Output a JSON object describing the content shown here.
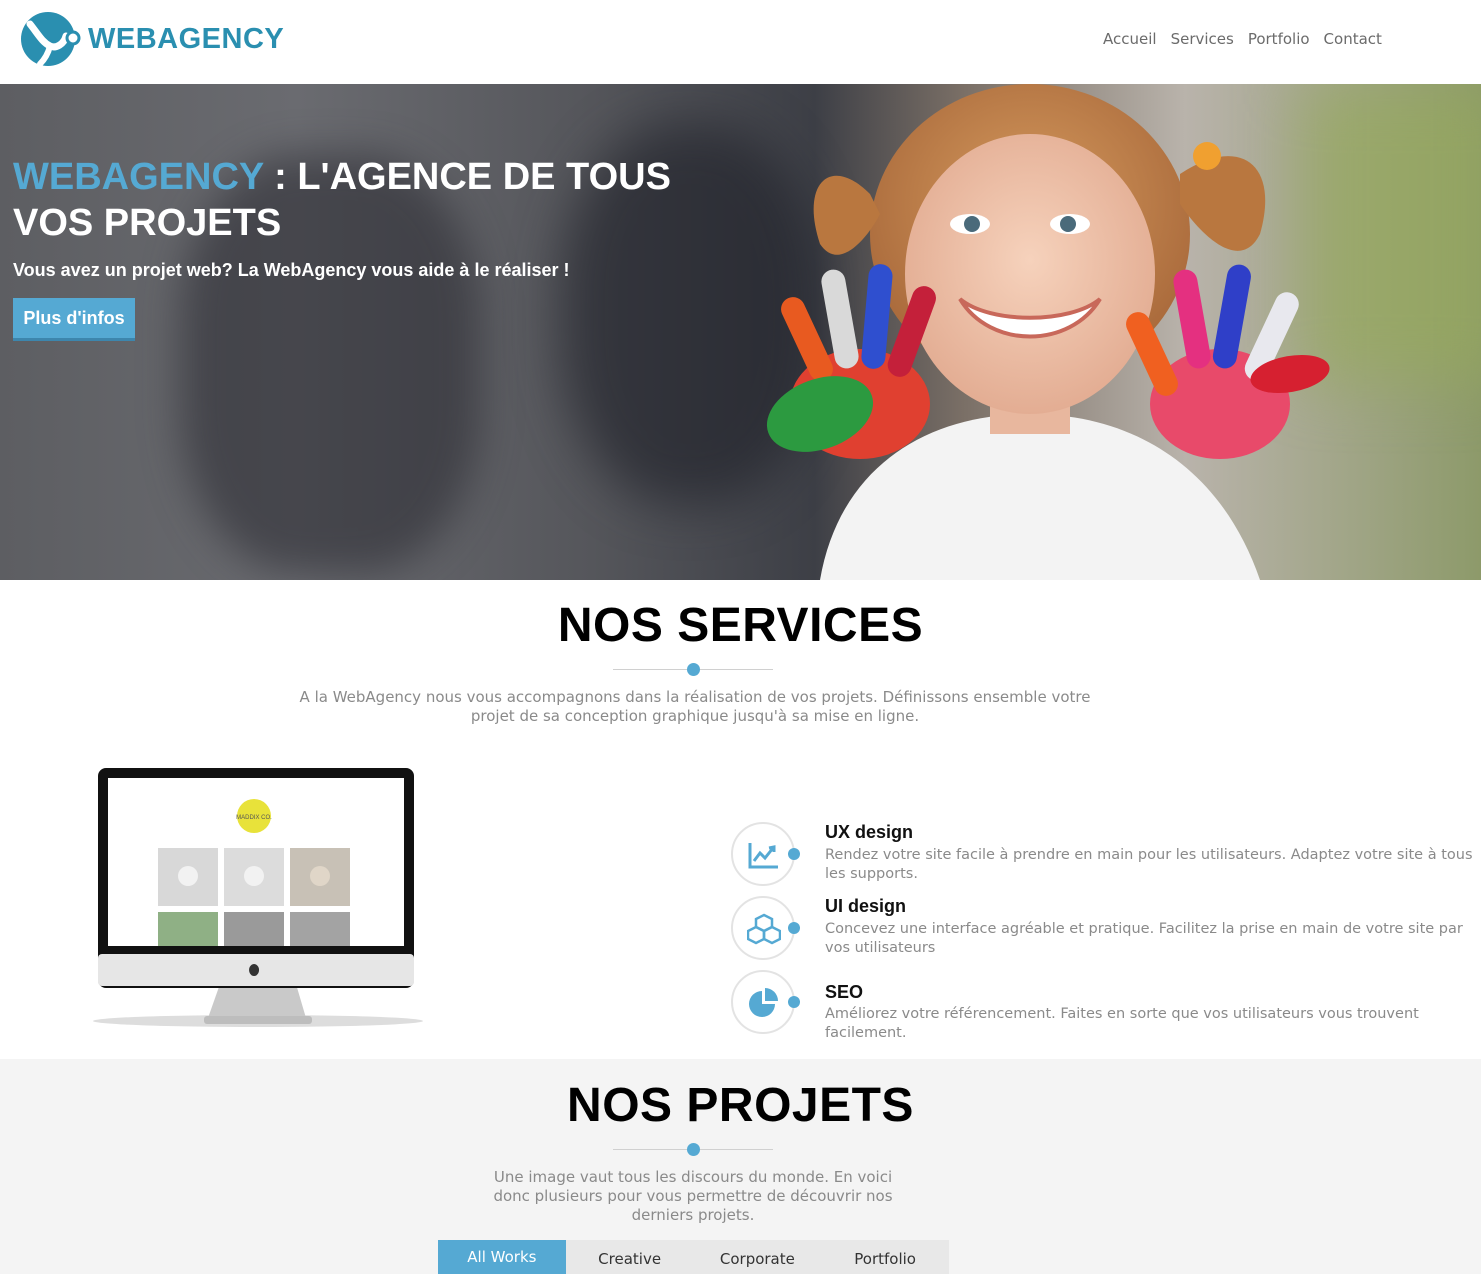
{
  "brand": {
    "name": "WEBAGENCY",
    "accent_color": "#55a9d3",
    "logo_color": "#2a8fb0"
  },
  "nav": {
    "items": [
      "Accueil",
      "Services",
      "Portfolio",
      "Contact"
    ]
  },
  "hero": {
    "title_accent": "WEBAGENCY",
    "title_rest": " : L'AGENCE DE TOUS VOS PROJETS",
    "subtitle": "Vous avez un projet web? La WebAgency vous aide à le réaliser !",
    "button_label": "Plus d'infos"
  },
  "services": {
    "title": "NOS SERVICES",
    "description": "A la WebAgency nous vous accompagnons dans la réalisation de vos projets. Définissons ensemble votre projet de sa conception graphique jusqu'à sa mise en ligne.",
    "items": [
      {
        "icon": "chart-icon",
        "title": "UX design",
        "text": "Rendez votre site facile à prendre en main pour les utilisateurs. Adaptez votre site à tous les supports."
      },
      {
        "icon": "cubes-icon",
        "title": "UI design",
        "text": "Concevez une interface agréable et pratique. Facilitez la prise en main de votre site par vos utilisateurs"
      },
      {
        "icon": "pie-chart-icon",
        "title": "SEO",
        "text": "Améliorez votre référencement. Faites en sorte que vos utilisateurs vous trouvent facilement."
      }
    ],
    "monitor_screen_logo": "MADDIX CO."
  },
  "projets": {
    "title": "NOS PROJETS",
    "description": "Une image vaut tous les discours du monde. En voici donc plusieurs pour vous permettre de découvrir nos derniers projets.",
    "filters": [
      "All Works",
      "Creative",
      "Corporate",
      "Portfolio"
    ],
    "active_filter": "All Works"
  }
}
